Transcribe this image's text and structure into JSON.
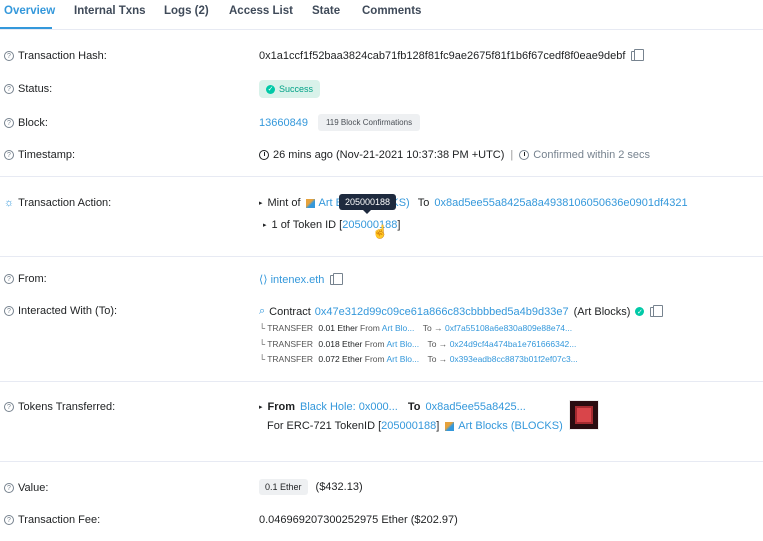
{
  "tabs": [
    "Overview",
    "Internal Txns",
    "Logs (2)",
    "Access List",
    "State",
    "Comments"
  ],
  "hash": {
    "label": "Transaction Hash:",
    "value": "0x1a1ccf1f52baa3824cab71fb128f81fc9ae2675f81f1b6f67cedf8f0eae9debf"
  },
  "status": {
    "label": "Status:",
    "value": "Success"
  },
  "block": {
    "label": "Block:",
    "number": "13660849",
    "confirmations": "119 Block Confirmations"
  },
  "timestamp": {
    "label": "Timestamp:",
    "value": "26 mins ago (Nov-21-2021 10:37:38 PM +UTC)",
    "separator": "|",
    "confirmed": "Confirmed within 2 secs"
  },
  "action": {
    "label": "Transaction Action:",
    "mint_prefix": "Mint of",
    "art_name_left": "Art Bl",
    "art_name_right": "CKS)",
    "to_label": "To",
    "to_address": "0x8ad5ee55a8425a8a4938106050636e0901df4321",
    "tooltip": "205000188",
    "token_line_prefix": "1 of Token ID [",
    "token_id": "205000188",
    "token_line_suffix": "]"
  },
  "from": {
    "label": "From:",
    "value": "intenex.eth"
  },
  "interacted": {
    "label": "Interacted With (To):",
    "prefix": "Contract",
    "address": "0x47e312d99c09ce61a866c83cbbbbed5a4b9d33e7",
    "name": "(Art Blocks)",
    "transfers": [
      {
        "prefix": "└ TRANSFER",
        "amount": "0.01 Ether",
        "from_label": "From",
        "from": "Art Blo...",
        "to_label": "To →",
        "to": "0xf7a55108a6e830a809e88e74..."
      },
      {
        "prefix": "└ TRANSFER",
        "amount": "0.018 Ether",
        "from_label": "From",
        "from": "Art Blo...",
        "to_label": "To →",
        "to": "0x24d9cf4a474ba1e761666342..."
      },
      {
        "prefix": "└ TRANSFER",
        "amount": "0.072 Ether",
        "from_label": "From",
        "from": "Art Blo...",
        "to_label": "To →",
        "to": "0x393eadb8cc8873b01f2ef07c3..."
      }
    ]
  },
  "tokens": {
    "label": "Tokens Transferred:",
    "from_label": "From",
    "from": "Black Hole: 0x000...",
    "to_label": "To",
    "to": "0x8ad5ee55a8425...",
    "for_prefix": "For ERC-721 TokenID [",
    "token_id": "205000188",
    "for_suffix": "]",
    "collection": "Art Blocks (BLOCKS)"
  },
  "value": {
    "label": "Value:",
    "ether": "0.1 Ether",
    "usd": "($432.13)"
  },
  "fee": {
    "label": "Transaction Fee:",
    "value": "0.046969207300252975 Ether ($202.97)"
  },
  "colors": {
    "link": "#3498db",
    "success": "#00a186",
    "tooltip": "#1e2a3e"
  }
}
